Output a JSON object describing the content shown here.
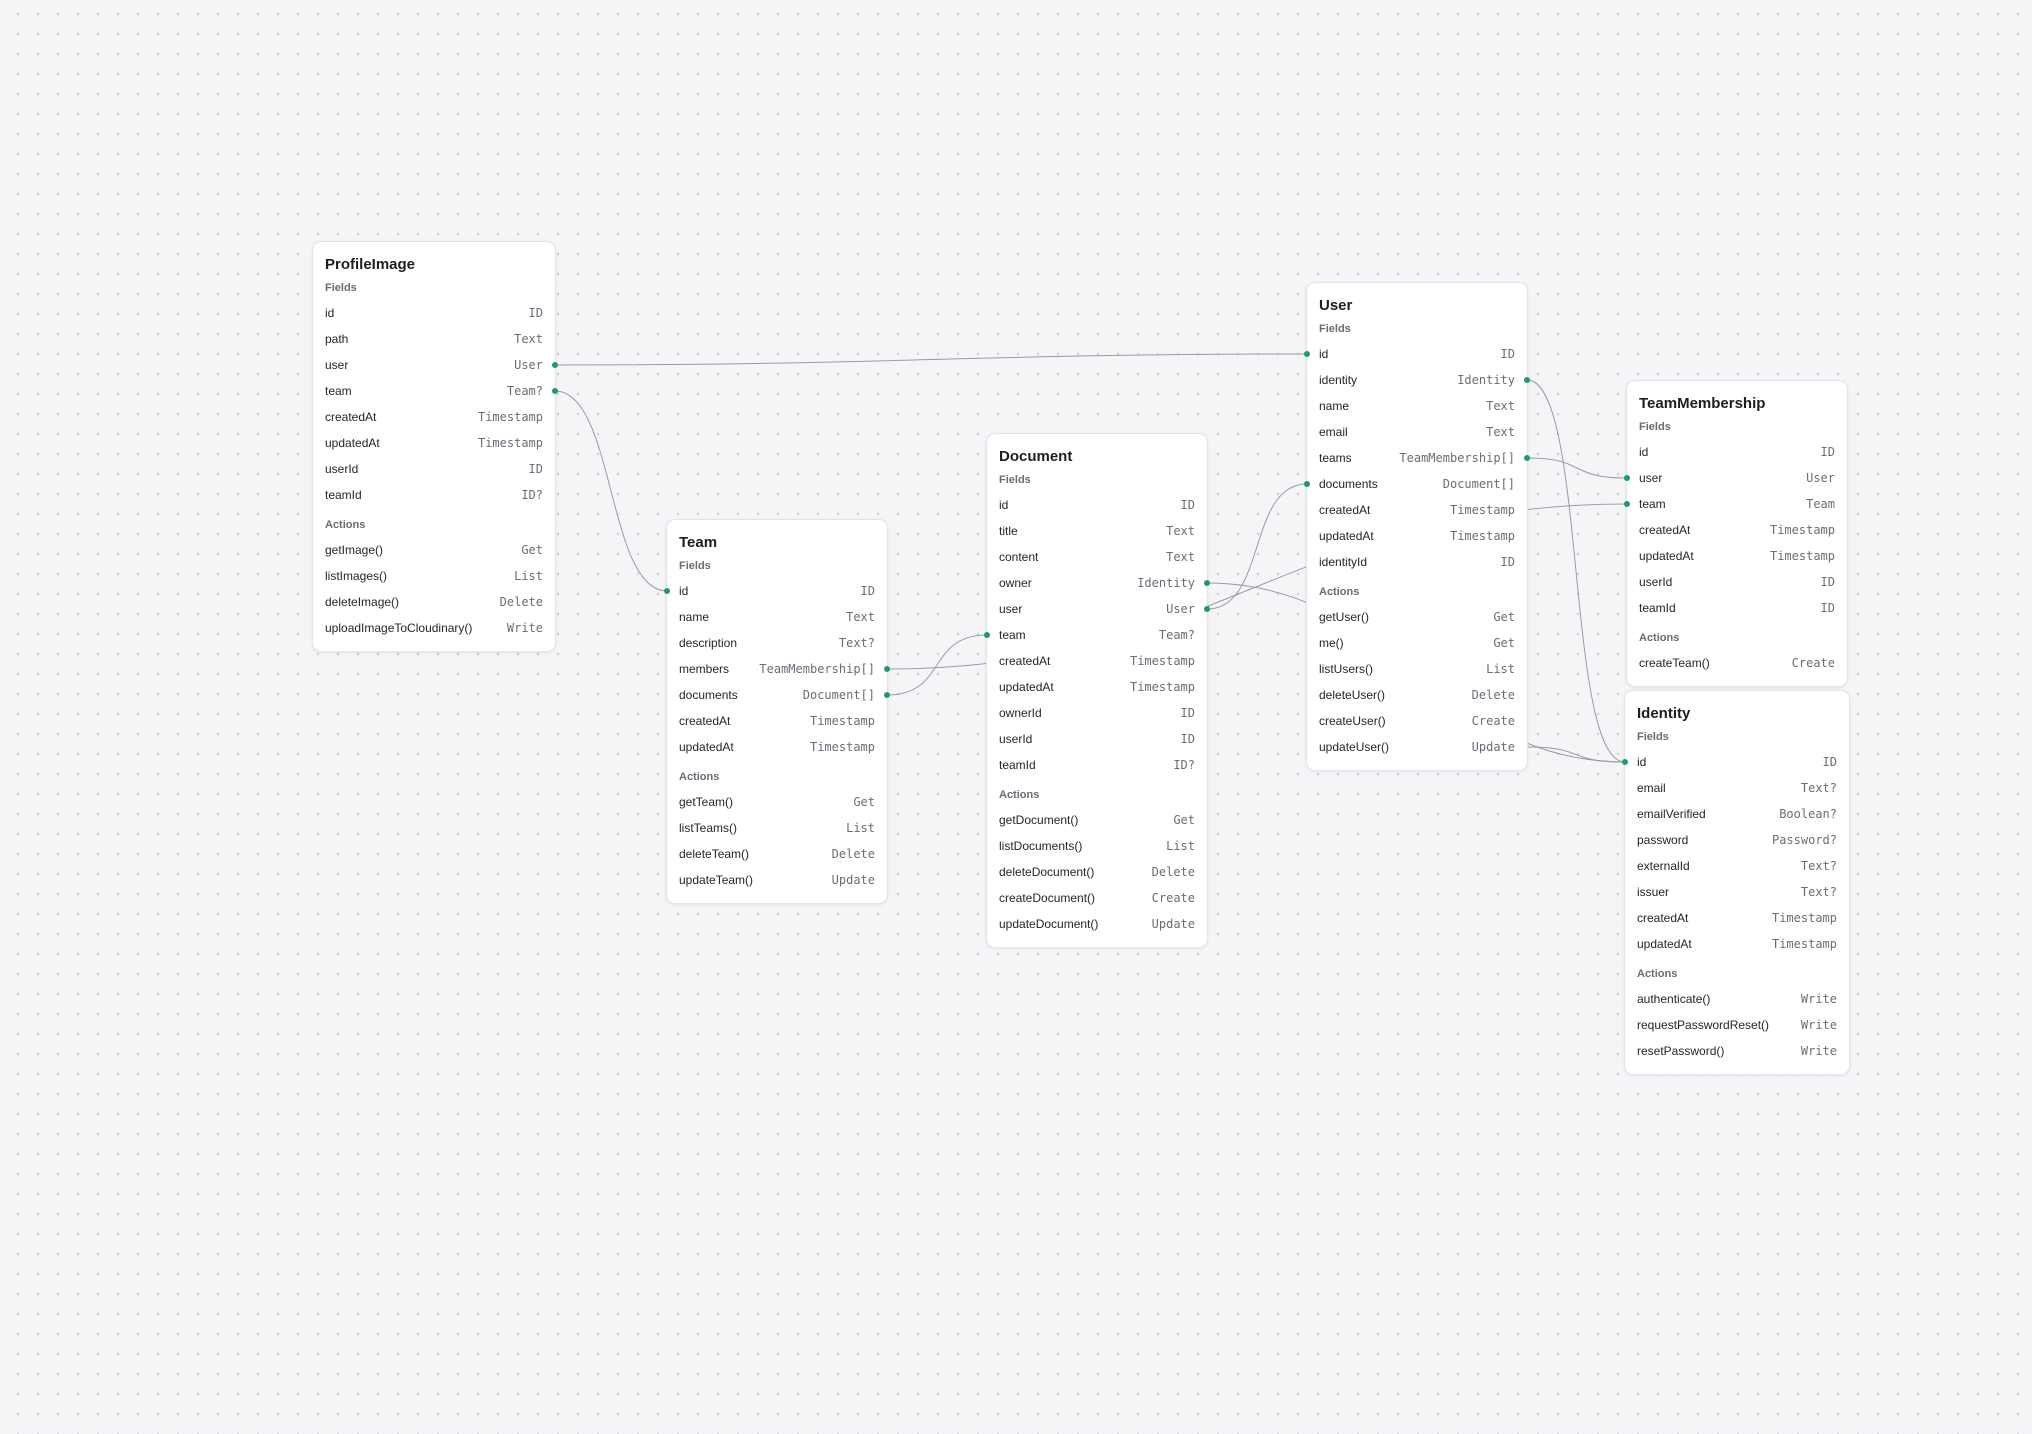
{
  "colors": {
    "port": "#1e9b6c",
    "edge": "#9a9aa6",
    "card_border": "#e3e3ea"
  },
  "fields_label": "Fields",
  "actions_label": "Actions",
  "models": [
    {
      "key": "profileimage",
      "title": "ProfileImage",
      "fields": [
        {
          "name": "id",
          "type": "ID"
        },
        {
          "name": "path",
          "type": "Text"
        },
        {
          "name": "user",
          "type": "User"
        },
        {
          "name": "team",
          "type": "Team?"
        },
        {
          "name": "createdAt",
          "type": "Timestamp"
        },
        {
          "name": "updatedAt",
          "type": "Timestamp"
        },
        {
          "name": "userId",
          "type": "ID"
        },
        {
          "name": "teamId",
          "type": "ID?"
        }
      ],
      "actions": [
        {
          "name": "getImage()",
          "type": "Get"
        },
        {
          "name": "listImages()",
          "type": "List"
        },
        {
          "name": "deleteImage()",
          "type": "Delete"
        },
        {
          "name": "uploadImageToCloudinary()",
          "type": "Write"
        }
      ]
    },
    {
      "key": "team",
      "title": "Team",
      "fields": [
        {
          "name": "id",
          "type": "ID"
        },
        {
          "name": "name",
          "type": "Text"
        },
        {
          "name": "description",
          "type": "Text?"
        },
        {
          "name": "members",
          "type": "TeamMembership[]"
        },
        {
          "name": "documents",
          "type": "Document[]"
        },
        {
          "name": "createdAt",
          "type": "Timestamp"
        },
        {
          "name": "updatedAt",
          "type": "Timestamp"
        }
      ],
      "actions": [
        {
          "name": "getTeam()",
          "type": "Get"
        },
        {
          "name": "listTeams()",
          "type": "List"
        },
        {
          "name": "deleteTeam()",
          "type": "Delete"
        },
        {
          "name": "updateTeam()",
          "type": "Update"
        }
      ]
    },
    {
      "key": "document",
      "title": "Document",
      "fields": [
        {
          "name": "id",
          "type": "ID"
        },
        {
          "name": "title",
          "type": "Text"
        },
        {
          "name": "content",
          "type": "Text"
        },
        {
          "name": "owner",
          "type": "Identity"
        },
        {
          "name": "user",
          "type": "User"
        },
        {
          "name": "team",
          "type": "Team?"
        },
        {
          "name": "createdAt",
          "type": "Timestamp"
        },
        {
          "name": "updatedAt",
          "type": "Timestamp"
        },
        {
          "name": "ownerId",
          "type": "ID"
        },
        {
          "name": "userId",
          "type": "ID"
        },
        {
          "name": "teamId",
          "type": "ID?"
        }
      ],
      "actions": [
        {
          "name": "getDocument()",
          "type": "Get"
        },
        {
          "name": "listDocuments()",
          "type": "List"
        },
        {
          "name": "deleteDocument()",
          "type": "Delete"
        },
        {
          "name": "createDocument()",
          "type": "Create"
        },
        {
          "name": "updateDocument()",
          "type": "Update"
        }
      ]
    },
    {
      "key": "user",
      "title": "User",
      "fields": [
        {
          "name": "id",
          "type": "ID"
        },
        {
          "name": "identity",
          "type": "Identity"
        },
        {
          "name": "name",
          "type": "Text"
        },
        {
          "name": "email",
          "type": "Text"
        },
        {
          "name": "teams",
          "type": "TeamMembership[]"
        },
        {
          "name": "documents",
          "type": "Document[]"
        },
        {
          "name": "createdAt",
          "type": "Timestamp"
        },
        {
          "name": "updatedAt",
          "type": "Timestamp"
        },
        {
          "name": "identityId",
          "type": "ID"
        }
      ],
      "actions": [
        {
          "name": "getUser()",
          "type": "Get"
        },
        {
          "name": "me()",
          "type": "Get"
        },
        {
          "name": "listUsers()",
          "type": "List"
        },
        {
          "name": "deleteUser()",
          "type": "Delete"
        },
        {
          "name": "createUser()",
          "type": "Create"
        },
        {
          "name": "updateUser()",
          "type": "Update"
        }
      ]
    },
    {
      "key": "teammembership",
      "title": "TeamMembership",
      "fields": [
        {
          "name": "id",
          "type": "ID"
        },
        {
          "name": "user",
          "type": "User"
        },
        {
          "name": "team",
          "type": "Team"
        },
        {
          "name": "createdAt",
          "type": "Timestamp"
        },
        {
          "name": "updatedAt",
          "type": "Timestamp"
        },
        {
          "name": "userId",
          "type": "ID"
        },
        {
          "name": "teamId",
          "type": "ID"
        }
      ],
      "actions": [
        {
          "name": "createTeam()",
          "type": "Create"
        }
      ]
    },
    {
      "key": "identity",
      "title": "Identity",
      "fields": [
        {
          "name": "id",
          "type": "ID"
        },
        {
          "name": "email",
          "type": "Text?"
        },
        {
          "name": "emailVerified",
          "type": "Boolean?"
        },
        {
          "name": "password",
          "type": "Password?"
        },
        {
          "name": "externalId",
          "type": "Text?"
        },
        {
          "name": "issuer",
          "type": "Text?"
        },
        {
          "name": "createdAt",
          "type": "Timestamp"
        },
        {
          "name": "updatedAt",
          "type": "Timestamp"
        }
      ],
      "actions": [
        {
          "name": "authenticate()",
          "type": "Write"
        },
        {
          "name": "requestPasswordReset()",
          "type": "Write"
        },
        {
          "name": "resetPassword()",
          "type": "Write"
        }
      ]
    }
  ]
}
